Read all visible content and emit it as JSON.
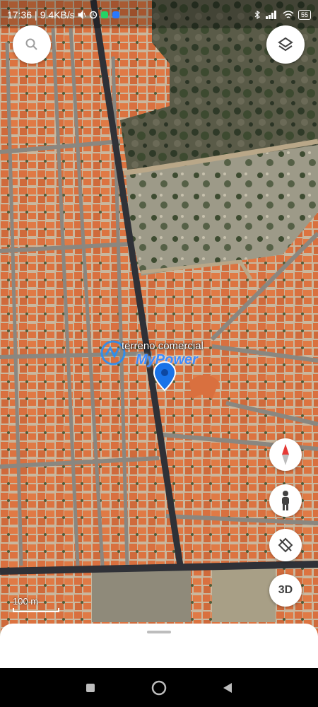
{
  "status_bar": {
    "time": "17:36",
    "speed": "9.4KB/s",
    "battery": "55"
  },
  "map": {
    "place_label": "terreno comercial",
    "watermark": "MyPower",
    "scale_label": "100 m"
  },
  "controls": {
    "search_icon": "search-icon",
    "layers_icon": "layers-icon",
    "compass_icon": "compass-icon",
    "street_view_icon": "pegman-icon",
    "tilt_icon": "tilt-icon",
    "three_d_label": "3D"
  },
  "colors": {
    "roof": "#d9703f",
    "street": "#7d7a73",
    "vegetation": "#3f4a33",
    "pin": "#1a73e8"
  }
}
